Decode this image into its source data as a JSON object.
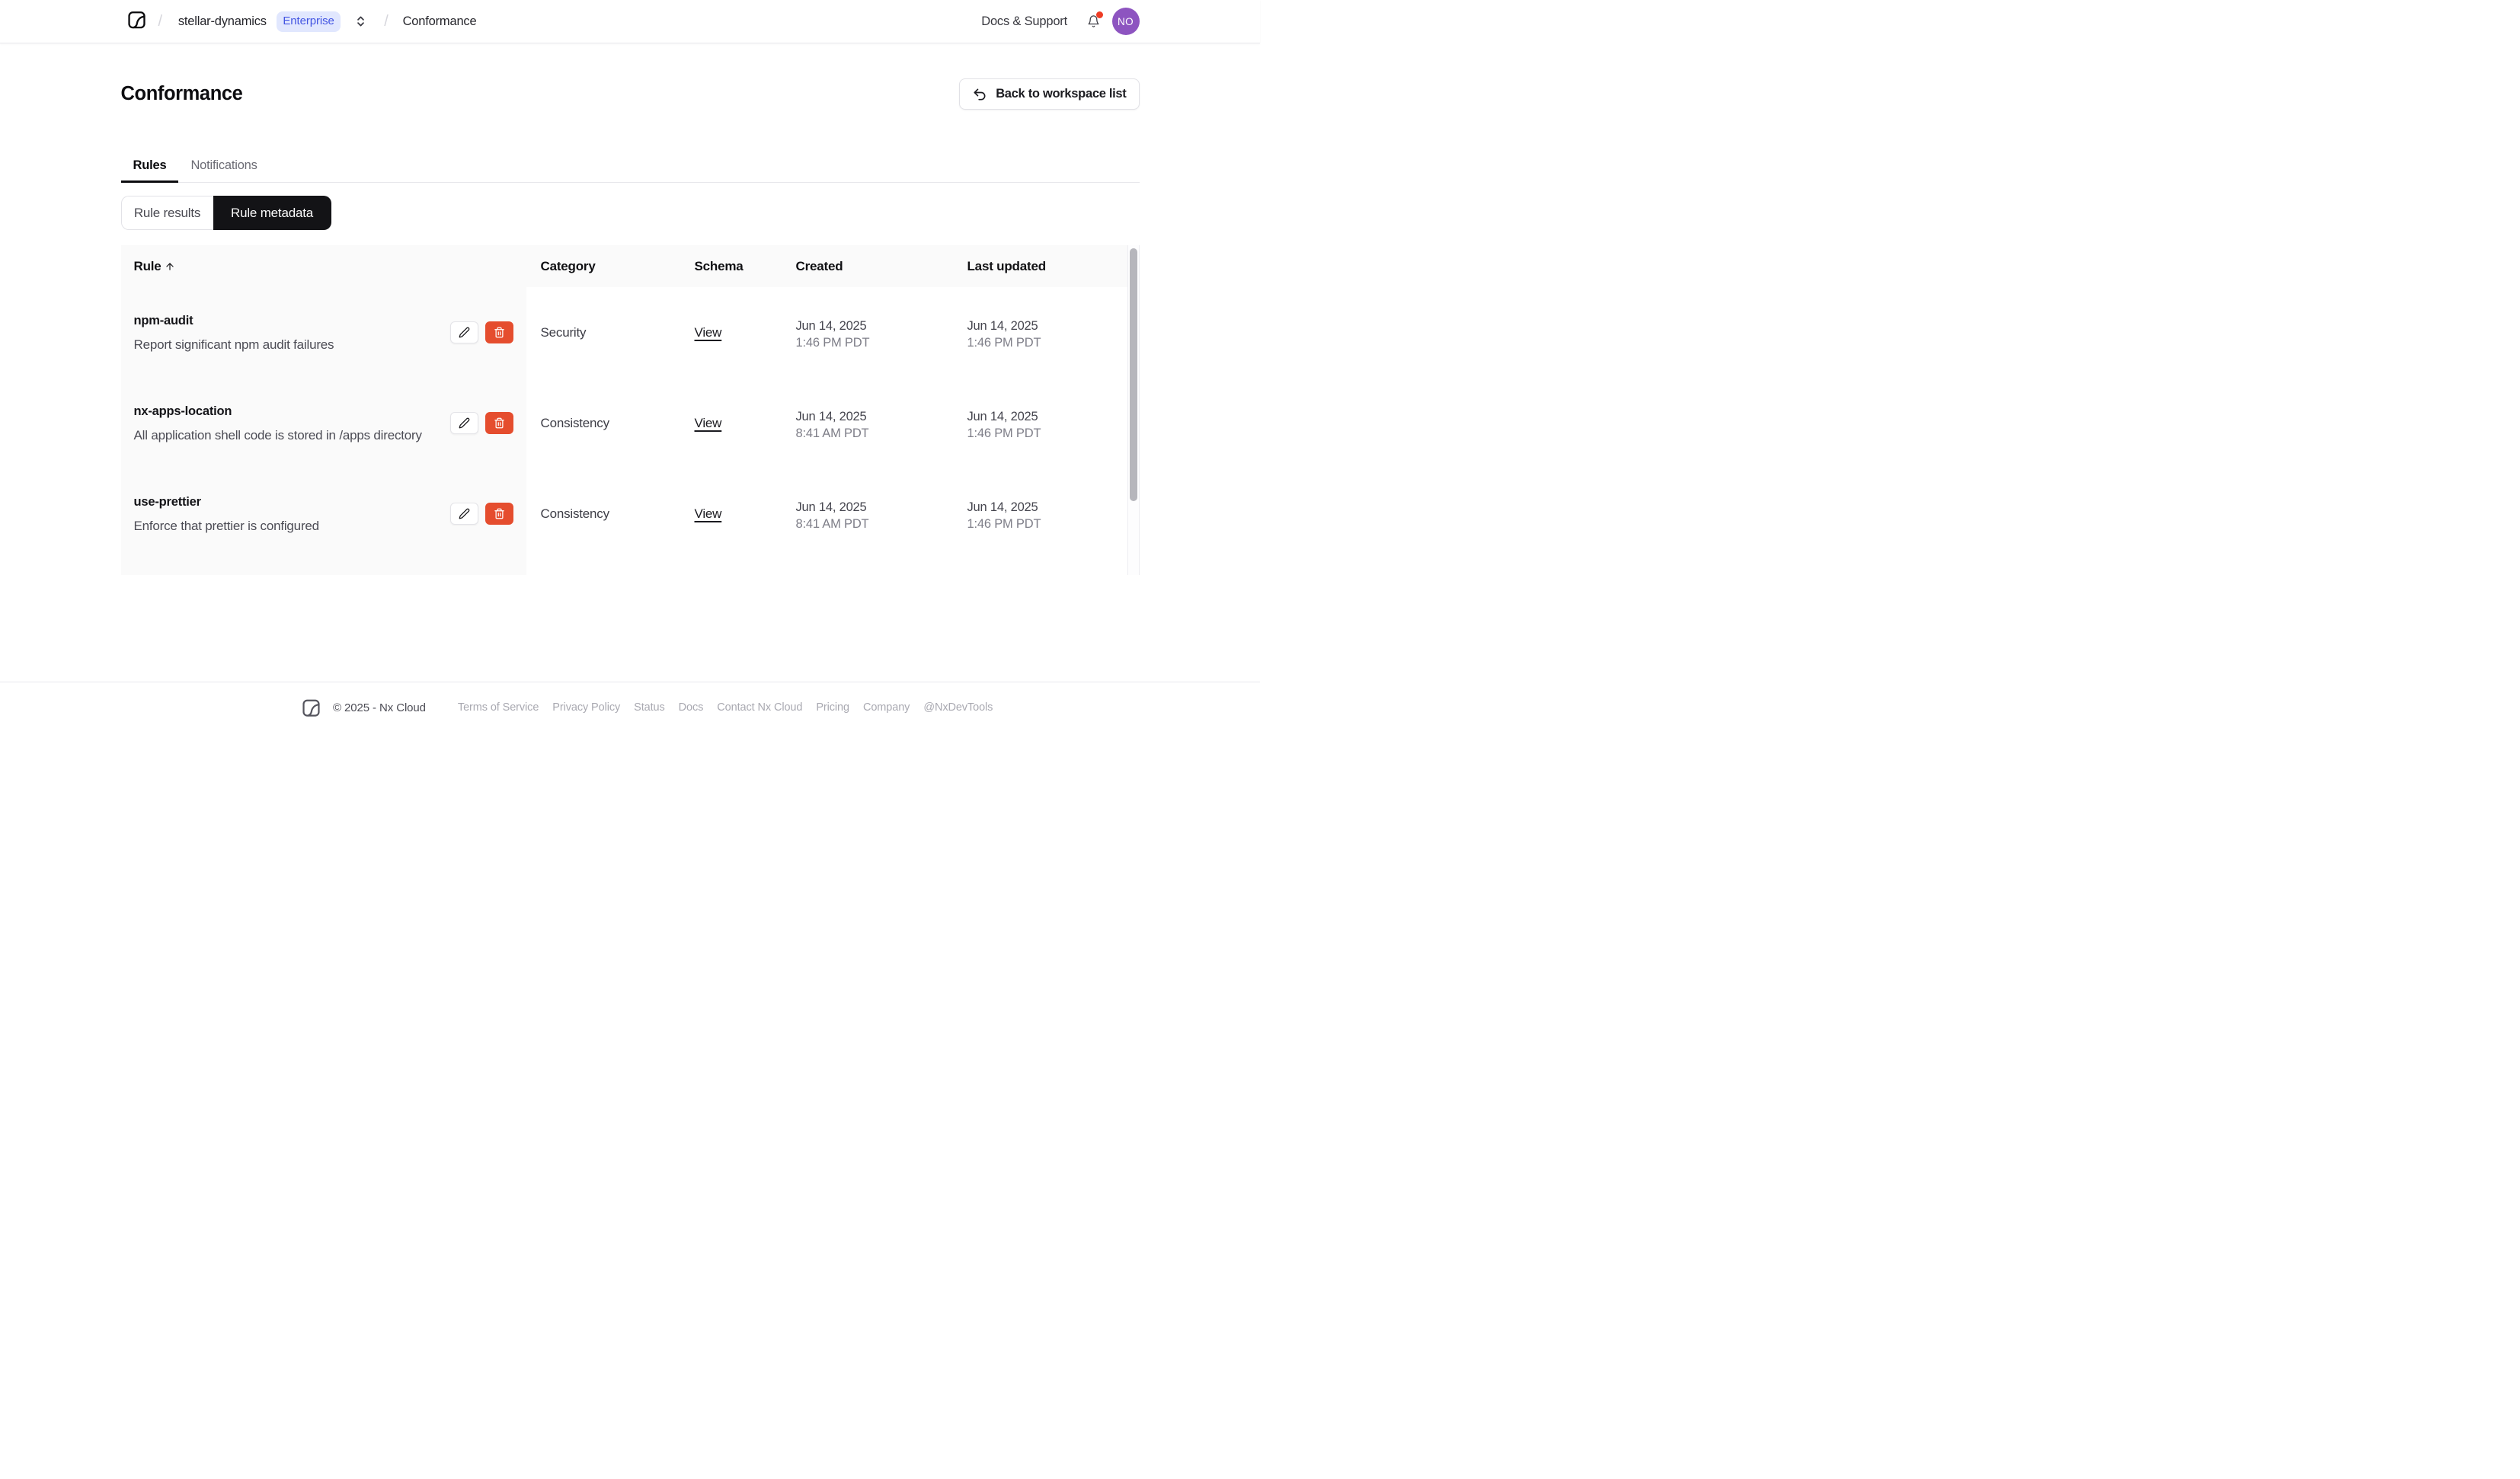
{
  "navbar": {
    "workspace": "stellar-dynamics",
    "workspace_badge": "Enterprise",
    "breadcrumb_page": "Conformance",
    "docs_support_label": "Docs & Support",
    "avatar_initials": "NO",
    "notification_dot_color": "#ee3c25",
    "avatar_color": "#8d54c0"
  },
  "page": {
    "title": "Conformance",
    "back_button_label": "Back to workspace list"
  },
  "tabs": [
    {
      "label": "Rules",
      "active": true
    },
    {
      "label": "Notifications",
      "active": false
    }
  ],
  "view_toggle": [
    {
      "label": "Rule results",
      "active": false
    },
    {
      "label": "Rule metadata",
      "active": true
    }
  ],
  "table": {
    "columns": [
      "Rule",
      "Category",
      "Schema",
      "Created",
      "Last updated"
    ],
    "sorted_column": "Rule",
    "sort_direction": "ascending",
    "schema_link_label": "View",
    "rows": [
      {
        "name": "npm-audit",
        "description": "Report significant npm audit failures",
        "category": "Security",
        "schema": "View",
        "created_date": "Jun 14, 2025",
        "created_time": "1:46 PM PDT",
        "updated_date": "Jun 14, 2025",
        "updated_time": "1:46 PM PDT"
      },
      {
        "name": "nx-apps-location",
        "description": "All application shell code is stored in /apps directory",
        "category": "Consistency",
        "schema": "View",
        "created_date": "Jun 14, 2025",
        "created_time": "8:41 AM PDT",
        "updated_date": "Jun 14, 2025",
        "updated_time": "1:46 PM PDT"
      },
      {
        "name": "use-prettier",
        "description": "Enforce that prettier is configured",
        "category": "Consistency",
        "schema": "View",
        "created_date": "Jun 14, 2025",
        "created_time": "8:41 AM PDT",
        "updated_date": "Jun 14, 2025",
        "updated_time": "1:46 PM PDT"
      }
    ]
  },
  "footer": {
    "copyright": "© 2025 - Nx Cloud",
    "links": [
      "Terms of Service",
      "Privacy Policy",
      "Status",
      "Docs",
      "Contact Nx Cloud",
      "Pricing",
      "Company",
      "@NxDevTools"
    ]
  },
  "colors": {
    "accent_badge_bg": "#e1e7fe",
    "accent_badge_text": "#4355e2",
    "delete_button": "#e54d2e",
    "active_segment": "#131316",
    "table_zebra_bg": "#fafafa"
  }
}
